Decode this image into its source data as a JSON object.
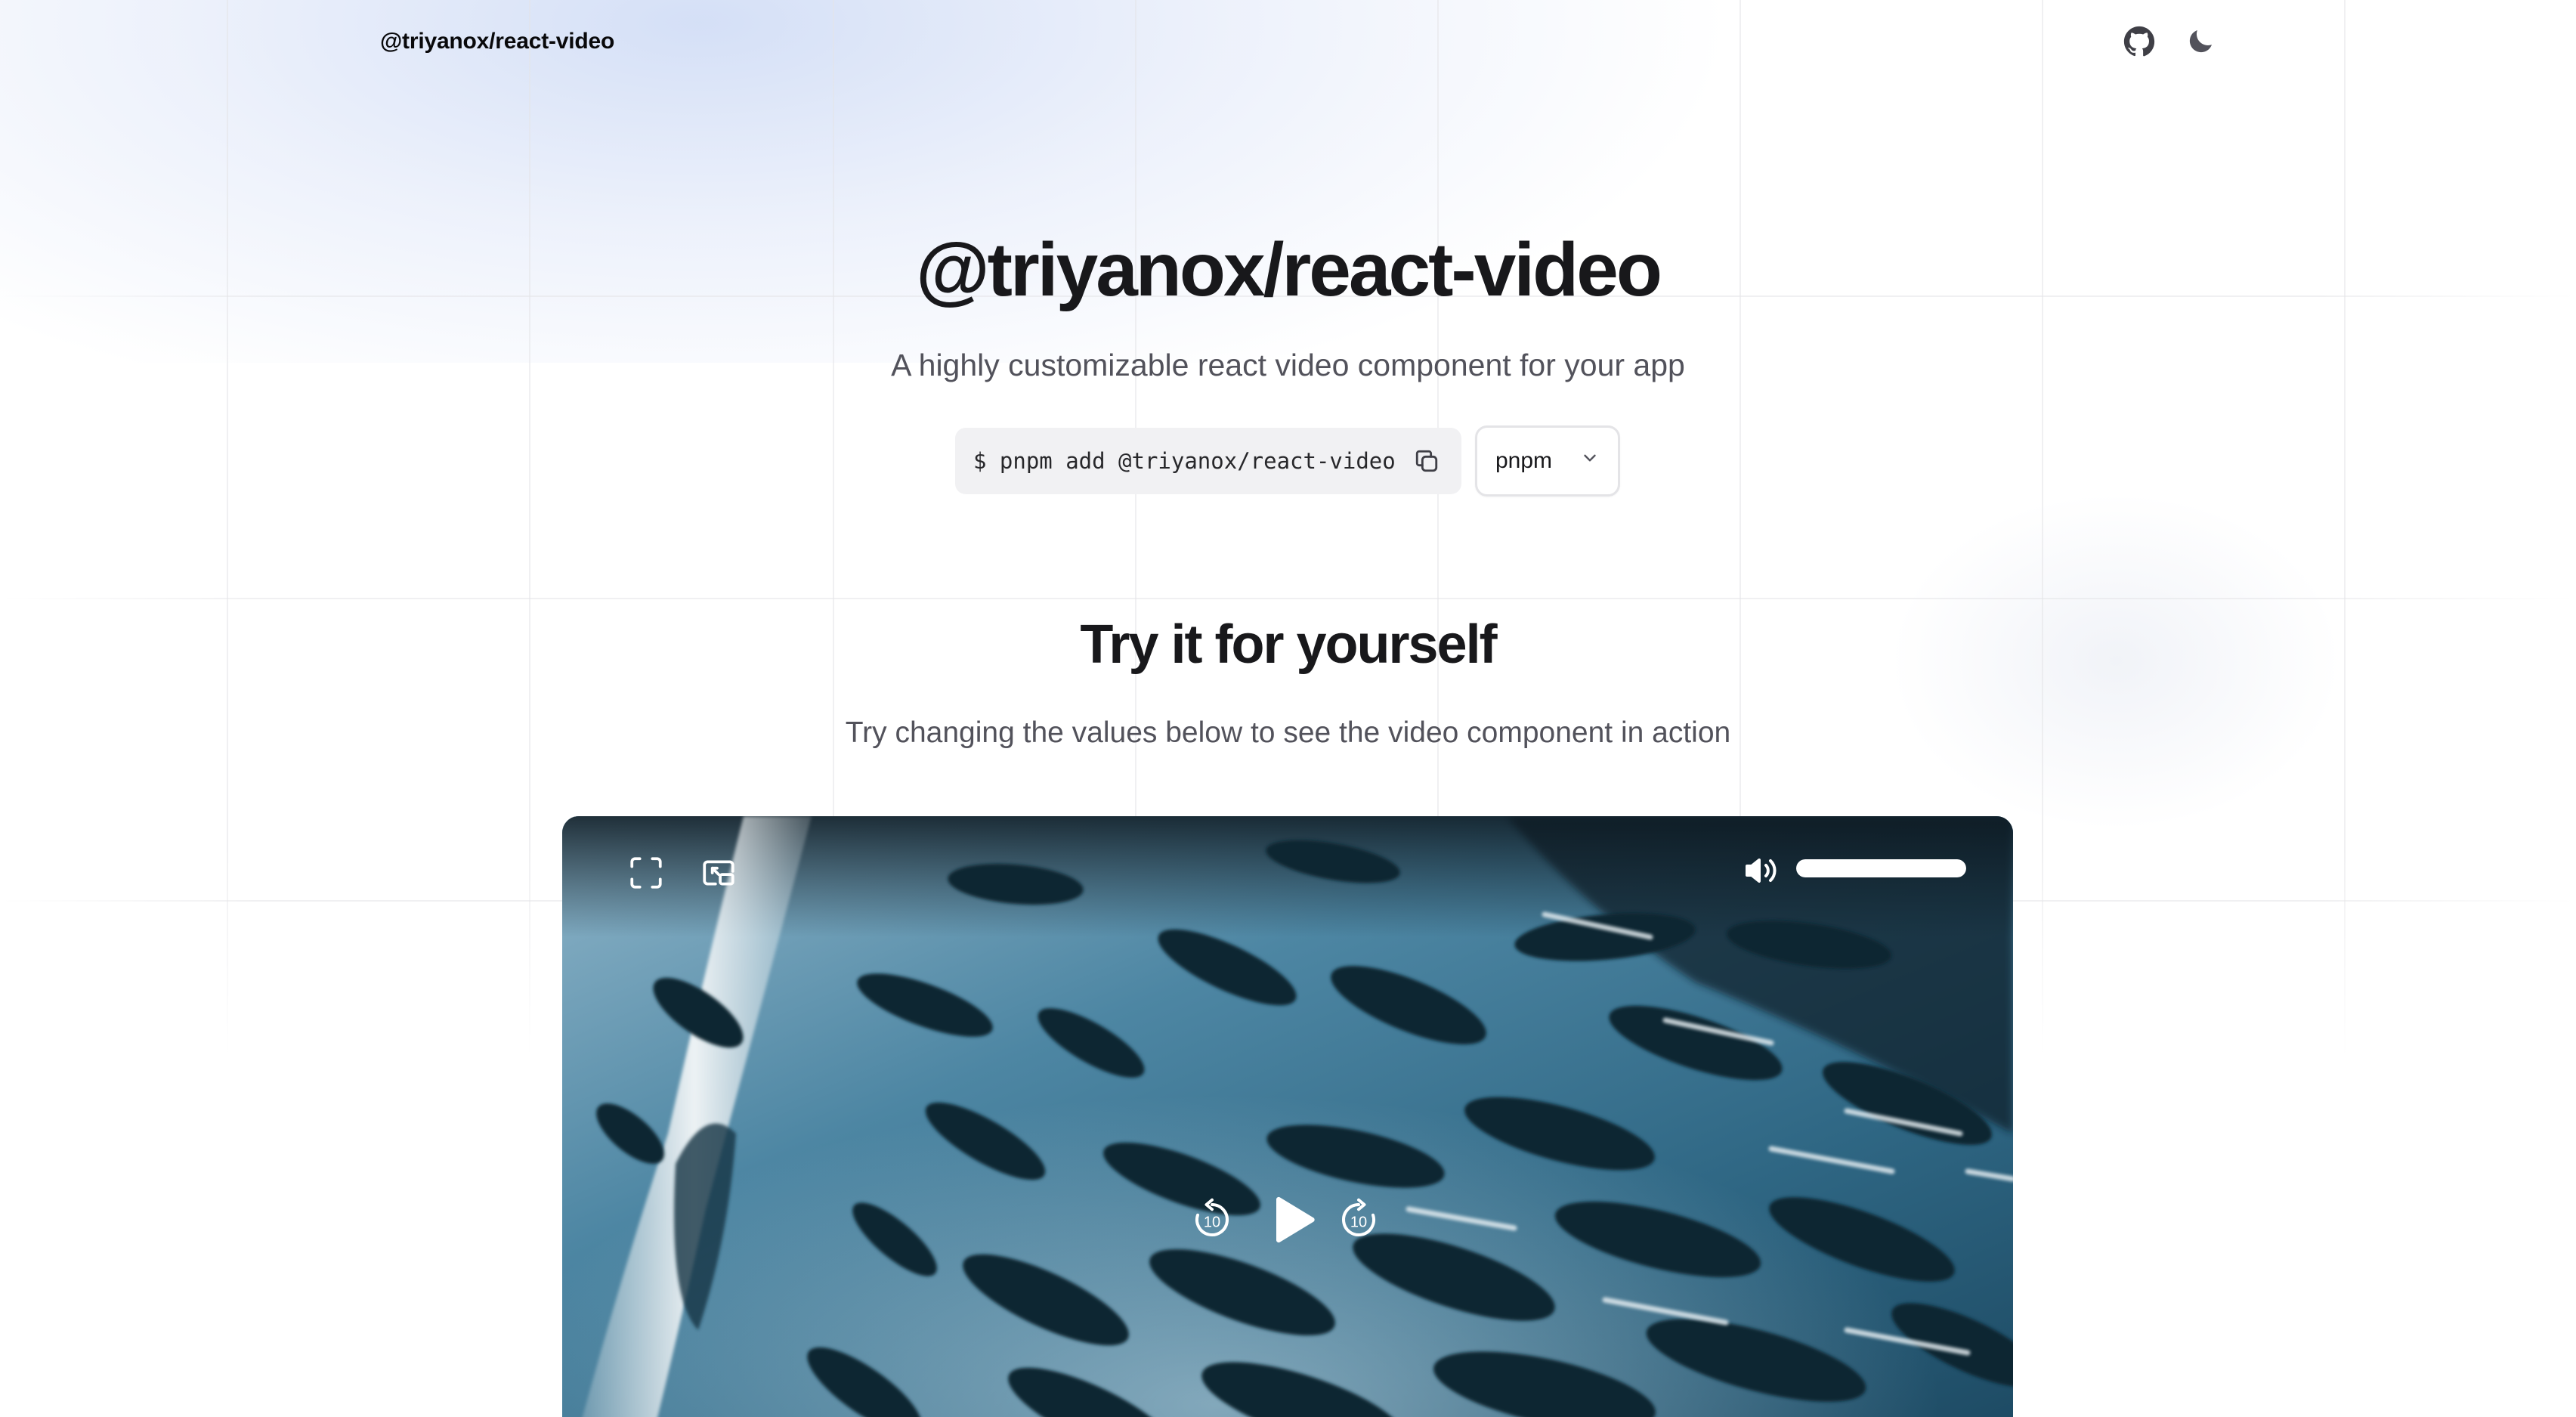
{
  "header": {
    "brand": "@triyanox/react-video",
    "icons": [
      "github-icon",
      "moon-icon"
    ]
  },
  "hero": {
    "title": "@triyanox/react-video",
    "subtitle": "A highly customizable react video component for your app",
    "install_command": "$ pnpm add @triyanox/react-video",
    "package_manager": "pnpm"
  },
  "demo": {
    "title": "Try it for yourself",
    "subtitle": "Try changing the values below to see the video component in action"
  },
  "player": {
    "volume_level": 1.0,
    "skip_back_label": "10",
    "skip_forward_label": "10",
    "icons": [
      "fullscreen-icon",
      "picture-in-picture-icon",
      "volume-icon",
      "rewind-10-icon",
      "play-icon",
      "forward-10-icon"
    ]
  },
  "colors": {
    "text": "#18181b",
    "muted": "#52525b",
    "code_bg": "#f1f1f3",
    "video_water": "#2b5d78"
  }
}
